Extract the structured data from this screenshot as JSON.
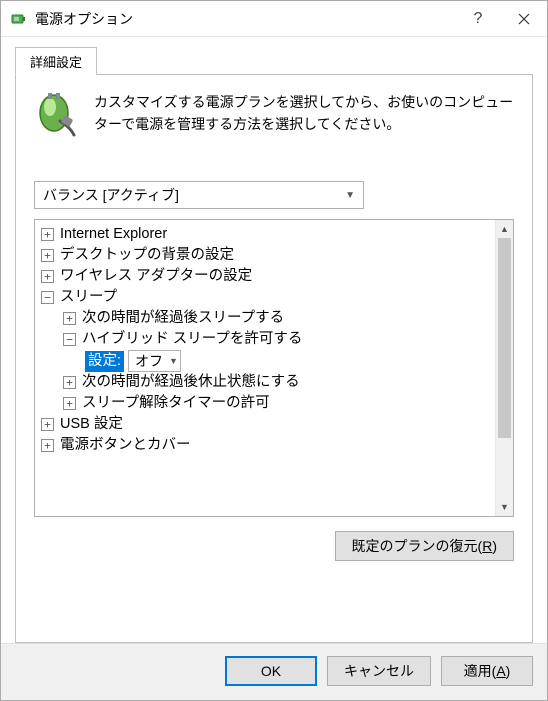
{
  "window": {
    "title": "電源オプション"
  },
  "tab": {
    "label": "詳細設定"
  },
  "intro": "カスタマイズする電源プランを選択してから、お使いのコンピューターで電源を管理する方法を選択してください。",
  "plan": {
    "selected": "バランス [アクティブ]"
  },
  "tree": {
    "items": [
      {
        "label": "Internet Explorer",
        "level": 0,
        "exp": "+"
      },
      {
        "label": "デスクトップの背景の設定",
        "level": 0,
        "exp": "+"
      },
      {
        "label": "ワイヤレス アダプターの設定",
        "level": 0,
        "exp": "+"
      },
      {
        "label": "スリープ",
        "level": 0,
        "exp": "−"
      },
      {
        "label": "次の時間が経過後スリープする",
        "level": 1,
        "exp": "+"
      },
      {
        "label": "ハイブリッド スリープを許可する",
        "level": 1,
        "exp": "−"
      },
      {
        "label_k": "設定:",
        "value": "オフ",
        "level": 2,
        "type": "setting"
      },
      {
        "label": "次の時間が経過後休止状態にする",
        "level": 1,
        "exp": "+"
      },
      {
        "label": "スリープ解除タイマーの許可",
        "level": 1,
        "exp": "+"
      },
      {
        "label": "USB 設定",
        "level": 0,
        "exp": "+"
      },
      {
        "label": "電源ボタンとカバー",
        "level": 0,
        "exp": "+"
      }
    ]
  },
  "buttons": {
    "restore_pre": "既定のプランの復元(",
    "restore_key": "R",
    "restore_post": ")",
    "ok": "OK",
    "cancel": "キャンセル",
    "apply_pre": "適用(",
    "apply_key": "A",
    "apply_post": ")"
  }
}
